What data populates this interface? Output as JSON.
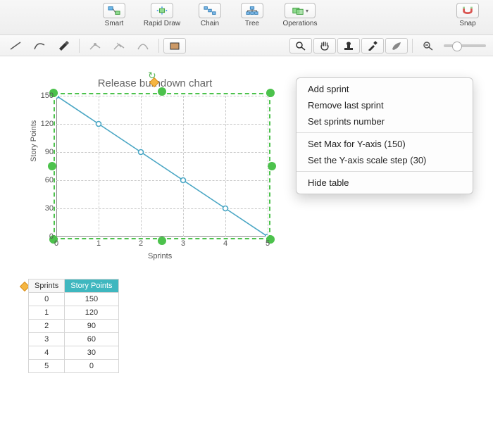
{
  "toolbar": {
    "smart": "Smart",
    "rapid": "Rapid Draw",
    "chain": "Chain",
    "tree": "Tree",
    "operations": "Operations",
    "snap": "Snap"
  },
  "chart_data": {
    "type": "line",
    "title": "Release burndown chart",
    "xlabel": "Sprints",
    "ylabel": "Story Points",
    "categories": [
      0,
      1,
      2,
      3,
      4,
      5
    ],
    "values": [
      150,
      120,
      90,
      60,
      30,
      0
    ],
    "xlim": [
      0,
      5
    ],
    "ylim": [
      0,
      150
    ],
    "y_step": 30,
    "yticks": [
      0,
      30,
      60,
      90,
      120,
      150
    ],
    "series_color": "#4aa6c4"
  },
  "table": {
    "headers": {
      "sprints": "Sprints",
      "points": "Story Points"
    },
    "rows": [
      {
        "s": "0",
        "p": "150"
      },
      {
        "s": "1",
        "p": "120"
      },
      {
        "s": "2",
        "p": "90"
      },
      {
        "s": "3",
        "p": "60"
      },
      {
        "s": "4",
        "p": "30"
      },
      {
        "s": "5",
        "p": "0"
      }
    ]
  },
  "context_menu": {
    "add": "Add sprint",
    "remove": "Remove last sprint",
    "setnum": "Set sprints number",
    "ymax": "Set Max for Y-axis (150)",
    "ystep": "Set the Y-axis scale step (30)",
    "hide": "Hide table"
  }
}
